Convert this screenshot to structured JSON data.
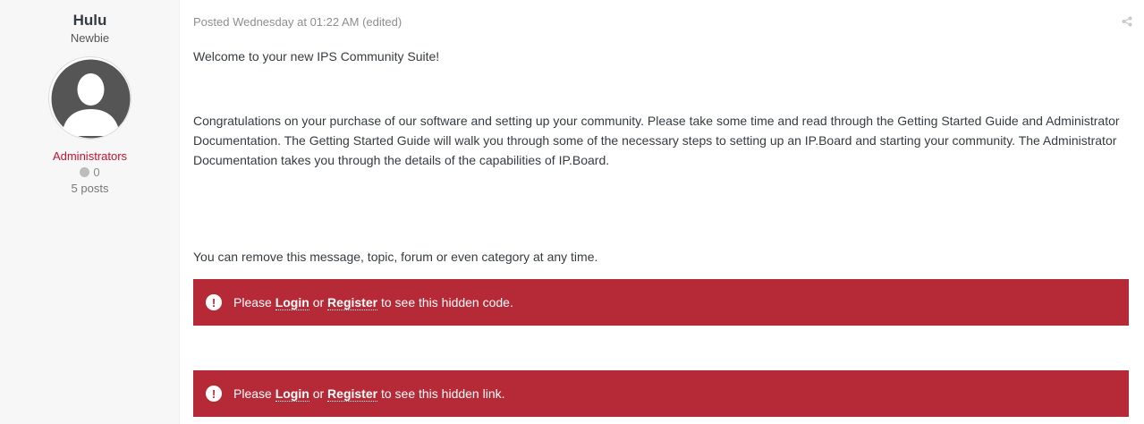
{
  "author": {
    "name": "Hulu",
    "rank": "Newbie",
    "group": "Administrators",
    "reputation": "0",
    "posts": "5 posts"
  },
  "post": {
    "meta": "Posted Wednesday at 01:22 AM (edited)",
    "paragraphs": [
      "Welcome to your new IPS Community Suite!",
      "Congratulations on your purchase of our software and setting up your community. Please take some time and read through the Getting Started Guide and Administrator Documentation. The Getting Started Guide will walk you through some of the necessary steps to setting up an IP.Board and starting your community. The Administrator Documentation takes you through the details of the capabilities of IP.Board.",
      "You can remove this message, topic, forum or even category at any time."
    ]
  },
  "hidden_notices": [
    {
      "icon": "exclamation-circle-icon",
      "prefix": "Please ",
      "login": "Login",
      "mid": " or ",
      "register": "Register",
      "suffix": " to see this hidden code."
    },
    {
      "icon": "exclamation-circle-icon",
      "prefix": "Please ",
      "login": "Login",
      "mid": " or ",
      "register": "Register",
      "suffix": " to see this hidden link."
    }
  ],
  "icons": {
    "share": "share-icon",
    "avatar": "default-avatar-icon",
    "reputation": "reputation-dot-icon"
  },
  "colors": {
    "notice_bg": "#b52a36",
    "group": "#c8102e",
    "sidebar_bg": "#f7f7f7"
  }
}
